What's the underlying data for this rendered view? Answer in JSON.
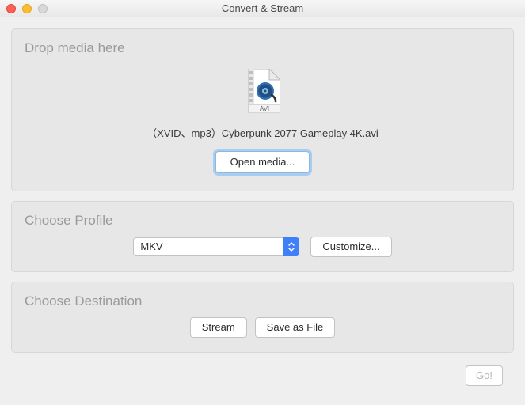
{
  "window": {
    "title": "Convert & Stream"
  },
  "drop": {
    "heading": "Drop media here",
    "file_type_badge": "AVI",
    "file_label": "（XVID、mp3）Cyberpunk 2077 Gameplay 4K.avi",
    "open_media_label": "Open media..."
  },
  "profile": {
    "heading": "Choose Profile",
    "selected": "MKV",
    "customize_label": "Customize..."
  },
  "destination": {
    "heading": "Choose Destination",
    "stream_label": "Stream",
    "save_label": "Save as File"
  },
  "footer": {
    "go_label": "Go!"
  }
}
